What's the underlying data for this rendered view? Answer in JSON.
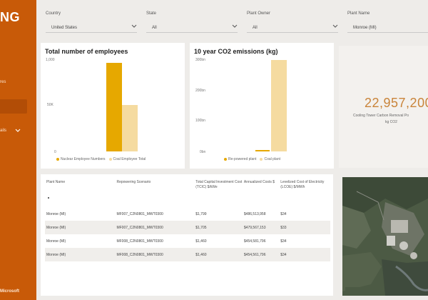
{
  "sidebar": {
    "logo": "NG",
    "items": [
      "res",
      "ails"
    ],
    "footer": "Microsoft"
  },
  "filters": [
    {
      "label": "Country",
      "value": "United States"
    },
    {
      "label": "State",
      "value": "All"
    },
    {
      "label": "Plant Owner",
      "value": "All"
    },
    {
      "label": "Plant Name",
      "value": "Monroe (MI)"
    }
  ],
  "employees_chart": {
    "title": "Total number of employees",
    "legend": [
      "Nuclear Employee Numbers",
      "Coal Employee Total"
    ],
    "colors": {
      "nuclear": "#e6a800",
      "coal": "#f5dba0"
    }
  },
  "co2_chart": {
    "title": "10 year CO2 emissions (kg)",
    "legend": [
      "Re-powered plant",
      "Coal plant"
    ],
    "colors": {
      "repowered": "#e6a800",
      "coal": "#f5dba0"
    }
  },
  "chart_data": [
    {
      "type": "bar",
      "title": "Total number of employees",
      "categories": [
        "Monroe (MI)"
      ],
      "series": [
        {
          "name": "Nuclear Employee Numbers",
          "values": [
            960
          ]
        },
        {
          "name": "Coal Employee Total",
          "values": [
            460
          ]
        }
      ],
      "ylim": [
        0,
        1000
      ],
      "yticks": [
        "0",
        "50K",
        "1,000"
      ]
    },
    {
      "type": "bar",
      "title": "10 year CO2 emissions (kg)",
      "categories": [
        "Monroe (MI)"
      ],
      "series": [
        {
          "name": "Re-powered plant",
          "values": [
            0.02
          ]
        },
        {
          "name": "Coal plant",
          "values": [
            3.2
          ]
        }
      ],
      "ylim": [
        0,
        3.5
      ],
      "yticks": [
        "0bn",
        "100bn",
        "200bn",
        "300bn"
      ]
    }
  ],
  "kpi": {
    "value": "22,957,200",
    "label_line1": "Cooling Tower Carbon Removal Po",
    "label_line2": "kg CO2"
  },
  "table": {
    "headers": [
      "Plant Name",
      "Repowering Scenario",
      "Total Capital Investment Cost (TCIC) $/kWe",
      "Annualized Costs $",
      "Levelized Cost of Electricity (LCOE) $/MWh"
    ],
    "rows": [
      [
        "Monroe (MI)",
        "MF007_C2N0801_MWT0300",
        "$1,799",
        "$486,513,958",
        "$34"
      ],
      [
        "Monroe (MI)",
        "MF007_C2N0801_MWT0300",
        "$1,705",
        "$479,567,153",
        "$33"
      ],
      [
        "Monroe (MI)",
        "MF008_C2N0801_MWT0300",
        "$1,460",
        "$454,581,796",
        "$34"
      ],
      [
        "Monroe (MI)",
        "MF008_C2N0801_MWT0300",
        "$1,460",
        "$454,561,796",
        "$34"
      ]
    ]
  }
}
